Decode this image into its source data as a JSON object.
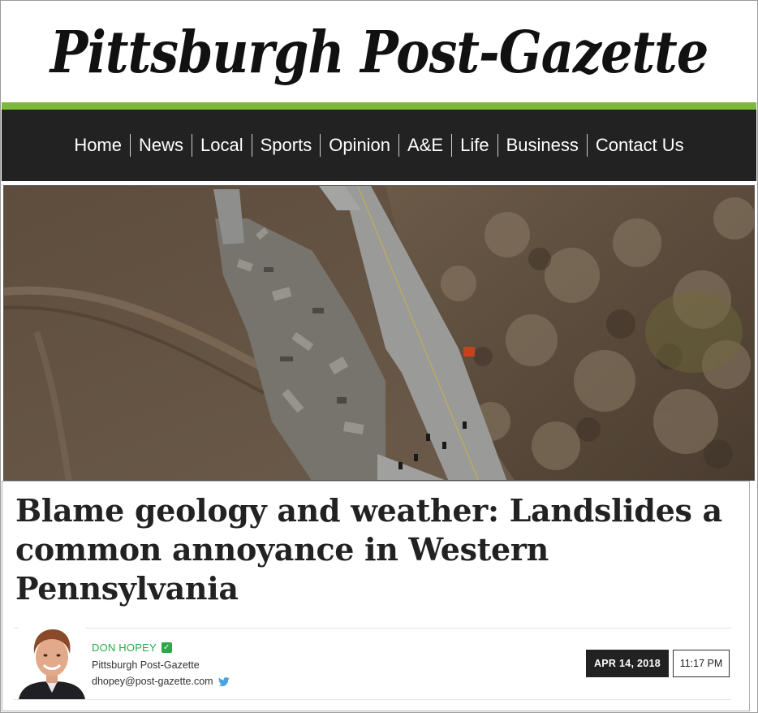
{
  "masthead": {
    "logo_text": "Pittsburgh Post-Gazette"
  },
  "nav": {
    "items": [
      {
        "label": "Home"
      },
      {
        "label": "News"
      },
      {
        "label": "Local"
      },
      {
        "label": "Sports"
      },
      {
        "label": "Opinion"
      },
      {
        "label": "A&E"
      },
      {
        "label": "Life"
      },
      {
        "label": "Business"
      },
      {
        "label": "Contact Us"
      }
    ]
  },
  "article": {
    "headline": "Blame geology and weather: Landslides a common annoyance in Western Pennsylvania",
    "author": {
      "name": "DON HOPEY",
      "organization": "Pittsburgh Post-Gazette",
      "email": "dhopey@post-gazette.com"
    },
    "date": "APR 14, 2018",
    "time": "11:17 PM"
  },
  "colors": {
    "accent_green": "#7dba3b",
    "nav_background": "#222222",
    "author_green": "#2aa84a"
  },
  "icons": {
    "verified": "verified-check-icon",
    "twitter": "twitter-bird-icon"
  }
}
